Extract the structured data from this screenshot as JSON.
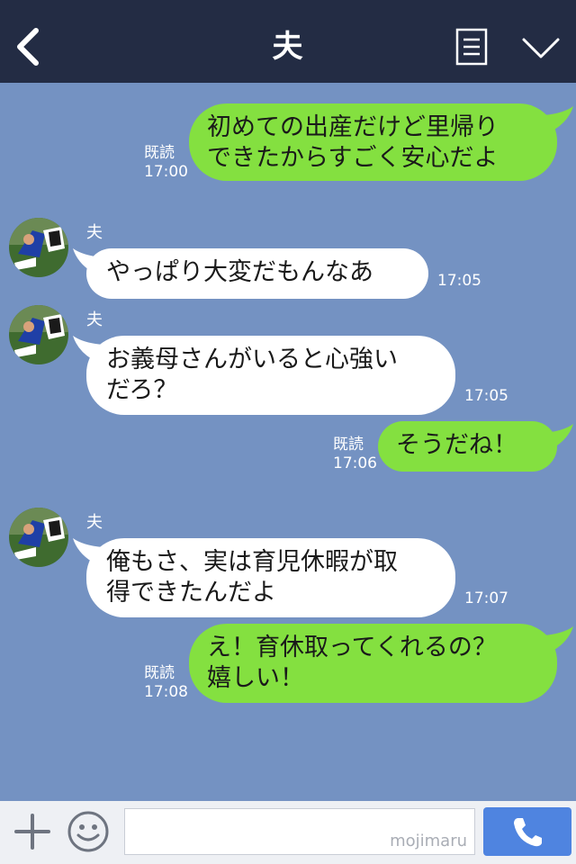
{
  "header": {
    "title": "夫"
  },
  "messages": [
    {
      "id": "m1",
      "side": "out",
      "text": "初めての出産だけど里帰り\nできたからすごく安心だよ",
      "read": "既読",
      "time": "17:00"
    },
    {
      "id": "m2",
      "side": "in",
      "sender": "夫",
      "text": "やっぱり大変だもんなあ",
      "time": "17:05"
    },
    {
      "id": "m3",
      "side": "in",
      "sender": "夫",
      "text": "お義母さんがいると心強い\nだろ？",
      "time": "17:05"
    },
    {
      "id": "m4",
      "side": "out",
      "text": "そうだね！",
      "read": "既読",
      "time": "17:06"
    },
    {
      "id": "m5",
      "side": "in",
      "sender": "夫",
      "text": "俺もさ、実は育児休暇が取\n得できたんだよ",
      "time": "17:07"
    },
    {
      "id": "m6",
      "side": "out",
      "text": "え！育休取ってくれるの？\n嬉しい！",
      "read": "既読",
      "time": "17:08"
    }
  ],
  "input": {
    "watermark": "mojimaru"
  },
  "icons": [
    "back-icon",
    "menu-icon",
    "chevron-down-icon",
    "plus-icon",
    "smile-icon",
    "phone-icon"
  ],
  "colors": {
    "header": "#232c44",
    "background": "#7492c2",
    "outgoing": "#84e040",
    "incoming": "#ffffff",
    "call_button": "#4f84e0"
  }
}
